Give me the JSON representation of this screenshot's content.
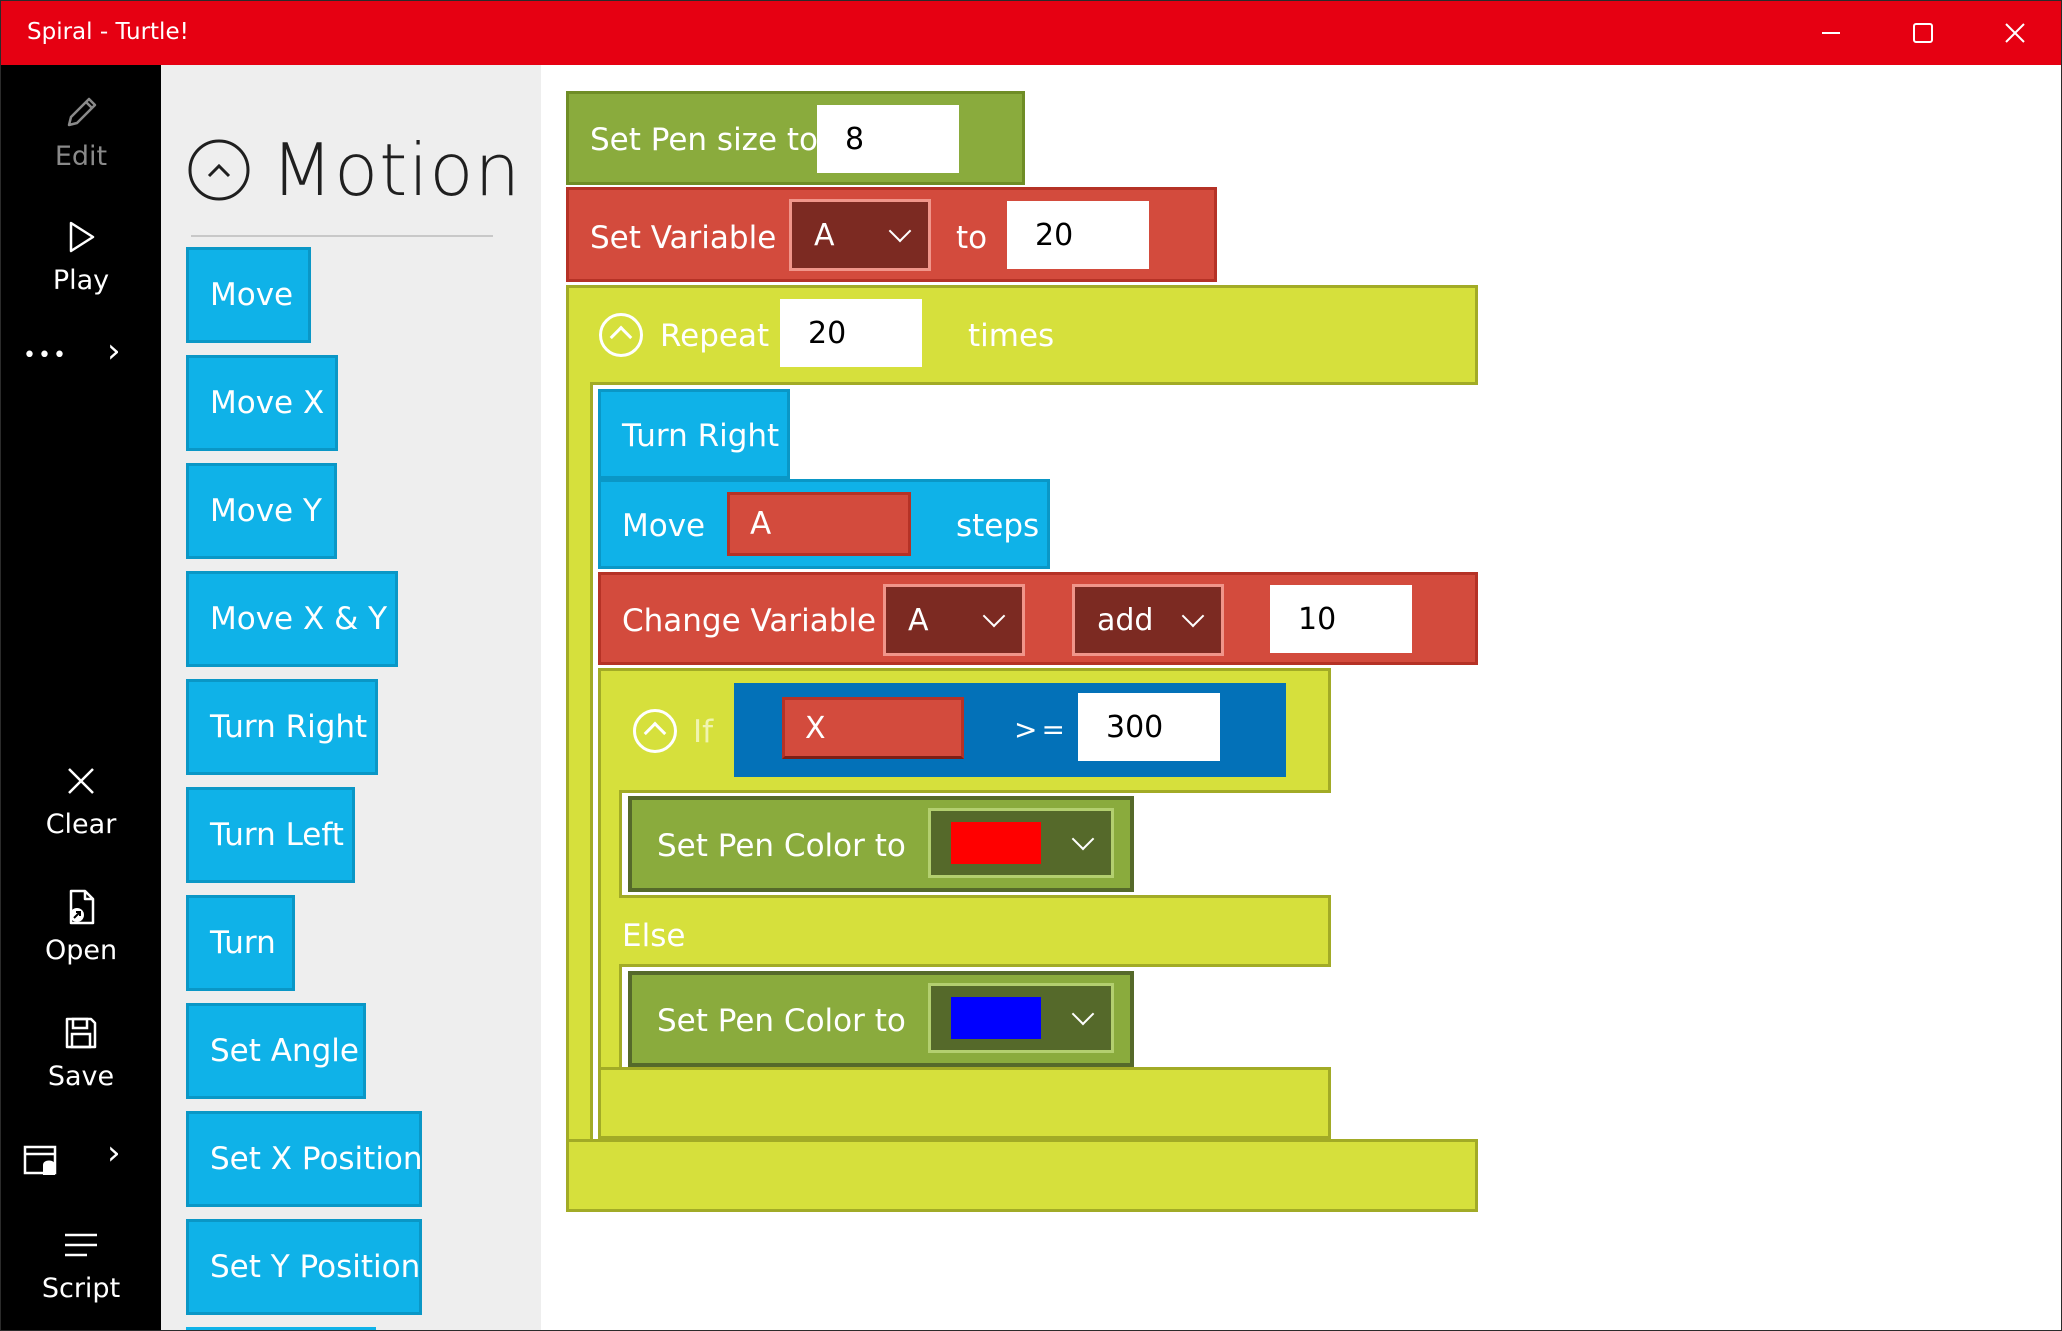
{
  "window": {
    "title": "Spiral - Turtle!",
    "controls": {
      "minimize": "─",
      "maximize": "☐",
      "close": "✕"
    }
  },
  "nav": {
    "edit": "Edit",
    "play": "Play",
    "more": "•••",
    "more_chevron": "›",
    "clear": "Clear",
    "open": "Open",
    "save": "Save",
    "store_chevron": "›",
    "script": "Script"
  },
  "palette": {
    "category": "Motion",
    "items": [
      "Move",
      "Move X",
      "Move Y",
      "Move X & Y",
      "Turn Right",
      "Turn Left",
      "Turn",
      "Set Angle",
      "Set X Position",
      "Set Y Position"
    ]
  },
  "script": {
    "pen_size": {
      "label": "Set Pen size to",
      "value": "8"
    },
    "set_var": {
      "label": "Set Variable",
      "var": "A",
      "to": "to",
      "value": "20"
    },
    "repeat": {
      "label": "Repeat",
      "count": "20",
      "times": "times"
    },
    "turn_right": {
      "label": "Turn Right"
    },
    "move": {
      "label": "Move",
      "value": "A",
      "steps": "steps"
    },
    "change_var": {
      "label": "Change Variable",
      "var": "A",
      "op": "add",
      "value": "10"
    },
    "if": {
      "label": "If",
      "left": "X",
      "op": ">=",
      "right": "300"
    },
    "pen_color_then": {
      "label": "Set Pen Color to",
      "color": "#ff0000"
    },
    "else": {
      "label": "Else"
    },
    "pen_color_else": {
      "label": "Set Pen Color to",
      "color": "#0000ff"
    }
  },
  "colors": {
    "titlebar": "#e60012",
    "motion_block": "#0fb2e8",
    "pen_block": "#8aab3d",
    "variable_block": "#d34b3d",
    "control_block": "#d6e03c",
    "condition_block": "#0371b8"
  }
}
